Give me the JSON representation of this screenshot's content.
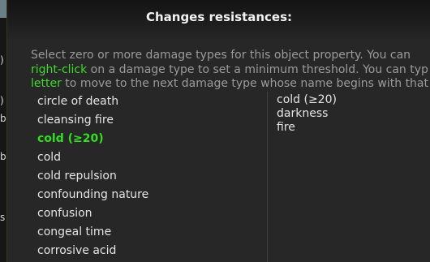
{
  "background": {
    "left_chars": [
      ")",
      ")",
      "b",
      "b",
      "s"
    ]
  },
  "dialog": {
    "title": "Changes resistances:",
    "description": {
      "line1": "Select zero or more damage types for this object property.  You can",
      "line2_link": "right-click",
      "line2_rest": " on a damage type to set a minimum threshold.  You can typ",
      "line3_link": "letter",
      "line3_rest": " to move to the next damage type whose name begins with that"
    },
    "left_list": [
      "circle of death",
      "cleansing fire",
      "cold (≥20)",
      "cold",
      "cold repulsion",
      "confounding nature",
      "confusion",
      "congeal time",
      "corrosive acid"
    ],
    "selected_index": 2,
    "right_list": [
      "cold (≥20)",
      "darkness",
      "fire"
    ]
  },
  "colors": {
    "accent_green": "#3fdc2a",
    "selected_green": "#2fe01a",
    "text": "#e4e4e4",
    "muted": "#9b9b9b"
  }
}
